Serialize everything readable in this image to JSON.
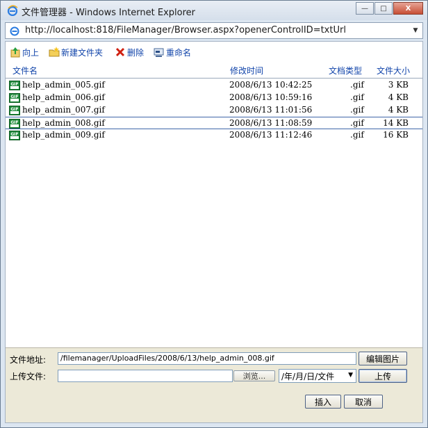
{
  "window": {
    "title": "文件管理器 - Windows Internet Explorer",
    "minimize_glyph": "—",
    "maximize_glyph": "□",
    "close_glyph": "X"
  },
  "address": {
    "url": "http://localhost:818/FileManager/Browser.aspx?openerControlID=txtUrl",
    "dropdown_glyph": "▼"
  },
  "toolbar": {
    "up_label": "向上",
    "new_folder_label": "新建文件夹",
    "delete_label": "删除",
    "rename_label": "重命名"
  },
  "columns": {
    "name": "文件名",
    "modified": "修改时间",
    "type": "文档类型",
    "size": "文件大小"
  },
  "files": [
    {
      "name": "help_admin_005.gif",
      "modified": "2008/6/13 10:42:25",
      "type": ".gif",
      "size": "3 KB",
      "selected": false
    },
    {
      "name": "help_admin_006.gif",
      "modified": "2008/6/13 10:59:16",
      "type": ".gif",
      "size": "4 KB",
      "selected": false
    },
    {
      "name": "help_admin_007.gif",
      "modified": "2008/6/13 11:01:56",
      "type": ".gif",
      "size": "4 KB",
      "selected": false
    },
    {
      "name": "help_admin_008.gif",
      "modified": "2008/6/13 11:08:59",
      "type": ".gif",
      "size": "14 KB",
      "selected": true
    },
    {
      "name": "help_admin_009.gif",
      "modified": "2008/6/13 11:12:46",
      "type": ".gif",
      "size": "16 KB",
      "selected": false
    }
  ],
  "file_icon_text": "GIF",
  "form": {
    "address_label": "文件地址:",
    "address_value": "/filemanager/UploadFiles/2008/6/13/help_admin_008.gif",
    "edit_image_button": "编辑图片",
    "upload_label": "上传文件:",
    "upload_value": "",
    "browse_button": "浏览...",
    "folder_select_value": "/年/月/日/文件",
    "upload_button": "上传",
    "insert_button": "插入",
    "cancel_button": "取消"
  }
}
